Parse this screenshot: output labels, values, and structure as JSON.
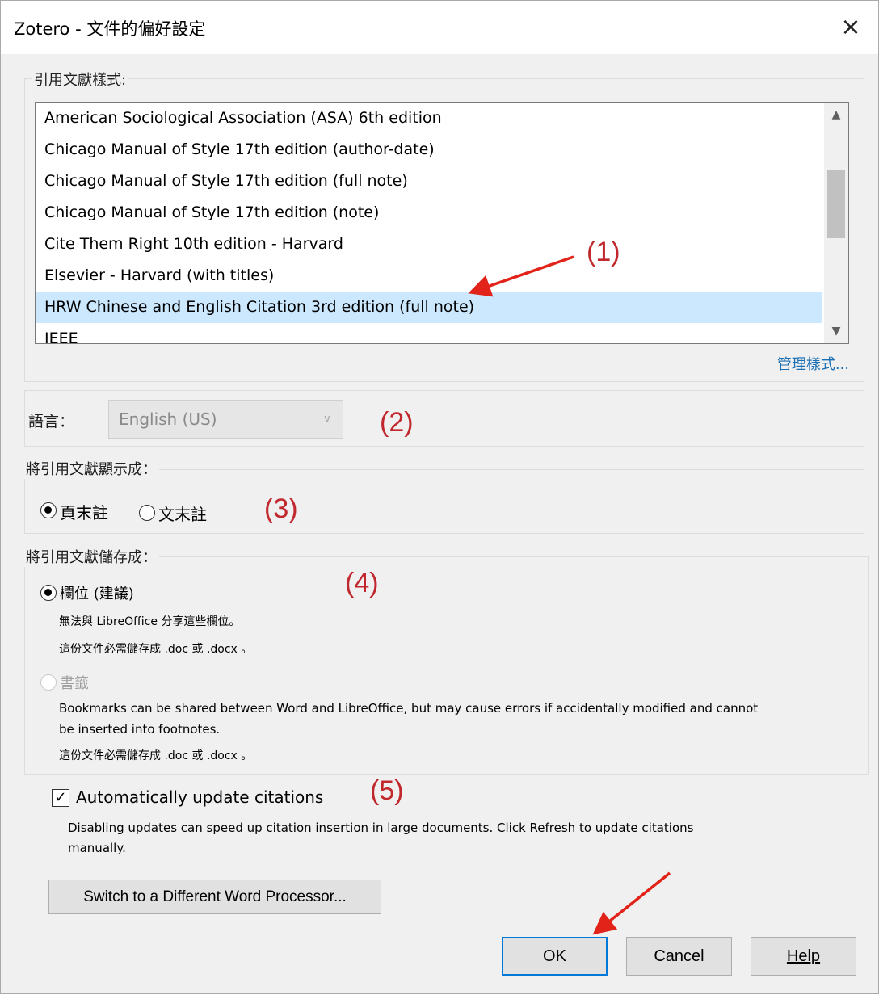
{
  "window": {
    "title": "Zotero - 文件的偏好設定",
    "close_icon": "×"
  },
  "styles_group": {
    "label": "引用文獻樣式:",
    "items": [
      "American Sociological Association (ASA) 6th edition",
      "Chicago Manual of Style 17th edition (author-date)",
      "Chicago Manual of Style 17th edition (full note)",
      "Chicago Manual of Style 17th edition (note)",
      "Cite Them Right 10th edition - Harvard",
      "Elsevier - Harvard (with titles)",
      "HRW Chinese and English Citation 3rd edition (full note)",
      "IEEE"
    ],
    "selected_index": 6,
    "manage_link": "管理樣式..."
  },
  "language": {
    "label": "語言：",
    "value": "English (US)"
  },
  "display_group": {
    "label": "將引用文獻顯示成：",
    "footnotes": "頁末註",
    "endnotes": "文末註",
    "selected": "footnotes"
  },
  "storage_group": {
    "label": "將引用文獻儲存成：",
    "fields_label": "欄位 (建議)",
    "fields_note1": "無法與 LibreOffice 分享這些欄位。",
    "fields_note2": "這份文件必需儲存成 .doc 或 .docx 。",
    "bookmarks_label": "書籤",
    "bookmarks_note1": "Bookmarks can be shared between Word and LibreOffice, but may cause errors if accidentally modified and cannot",
    "bookmarks_note2": "be inserted into footnotes.",
    "bookmarks_note3": "這份文件必需儲存成 .doc 或 .docx 。",
    "selected": "fields"
  },
  "auto_update": {
    "label": "Automatically update citations",
    "checked": true,
    "note1": "Disabling updates can speed up citation insertion in large documents. Click Refresh to update citations",
    "note2": "manually."
  },
  "switch_button": "Switch to a Different Word Processor...",
  "buttons": {
    "ok": "OK",
    "cancel": "Cancel",
    "help": "Help"
  },
  "annotations": [
    "(1)",
    "(2)",
    "(3)",
    "(4)",
    "(5)"
  ],
  "colors": {
    "annotation": "#c0282d",
    "selection": "#cce8ff",
    "link": "#1a6fb5",
    "default_button_border": "#0078d7"
  }
}
